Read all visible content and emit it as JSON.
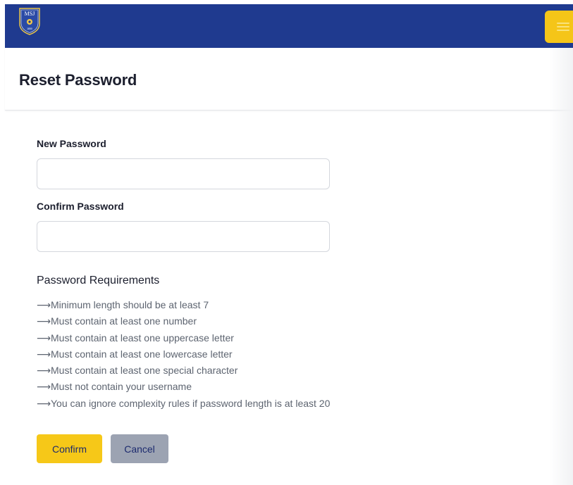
{
  "navbar": {
    "background": "#1f3a8f",
    "logo_text": "MSJ",
    "logo_subtext": "1850",
    "menu_button_color": "#f5c518",
    "menu_icon": "hamburger-icon"
  },
  "header": {
    "title": "Reset Password"
  },
  "form": {
    "new_password": {
      "label": "New Password",
      "value": "",
      "placeholder": ""
    },
    "confirm_password": {
      "label": "Confirm Password",
      "value": "",
      "placeholder": ""
    }
  },
  "requirements": {
    "title": "Password Requirements",
    "arrow_icon": "long-right-arrow-icon",
    "items": [
      "Minimum length should be at least 7",
      "Must contain at least one number",
      "Must contain at least one uppercase letter",
      "Must contain at least one lowercase letter",
      "Must contain at least one special character",
      "Must not contain your username",
      "You can ignore complexity rules if password length is at least 20"
    ]
  },
  "actions": {
    "confirm_label": "Confirm",
    "confirm_color": "#f6c818",
    "cancel_label": "Cancel",
    "cancel_color": "#9ca3b2"
  }
}
